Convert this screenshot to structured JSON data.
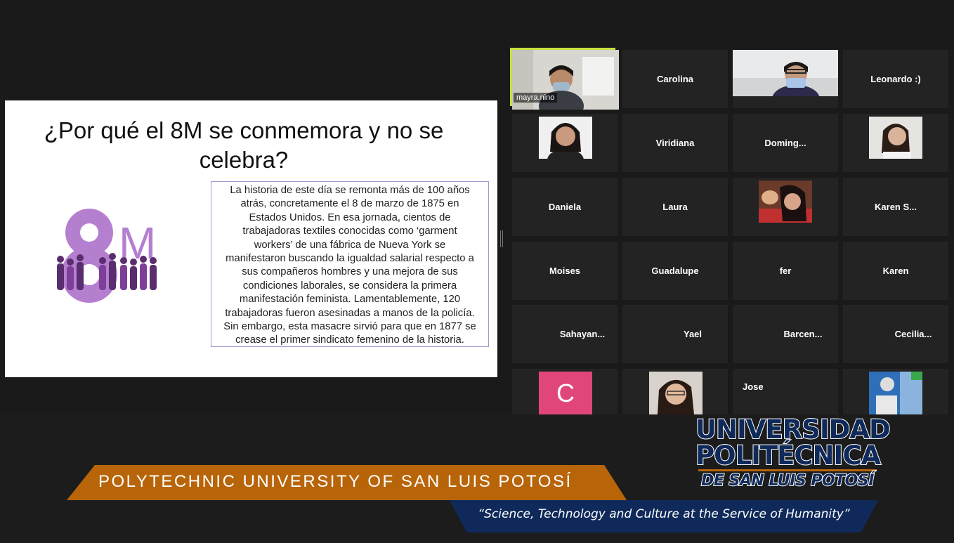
{
  "slide": {
    "title": "¿Por qué el 8M se conmemora y no se celebra?",
    "logo_text": "8M",
    "body": "La historia de este día se remonta más de 100 años\natrás, concretamente el 8 de marzo de 1875 en\nEstados Unidos. En esa jornada, cientos de\ntrabajadoras textiles conocidas como ‘garment\nworkers’ de una fábrica de Nueva York se\nmanifestaron buscando la igualdad salarial respecto a\nsus compañeros hombres y una mejora de sus\ncondiciones laborales, se considera la primera\nmanifestación feminista. Lamentablemente, 120\ntrabajadoras fueron asesinadas a manos de la policía.\nSin embargo, esta masacre sirvió para que en 1877 se\ncrease el primer sindicato femenino de la historia."
  },
  "participants": [
    {
      "name": "mayra.nino",
      "video": true
    },
    {
      "name": "Carolina"
    },
    {
      "name": "",
      "video": true
    },
    {
      "name": "Leonardo :)"
    },
    {
      "name": "",
      "video": true
    },
    {
      "name": "Viridiana"
    },
    {
      "name": "Doming..."
    },
    {
      "name": "",
      "video": true
    },
    {
      "name": "Daniela"
    },
    {
      "name": "Laura"
    },
    {
      "name": "",
      "video": true
    },
    {
      "name": "Karen S..."
    },
    {
      "name": "Moises"
    },
    {
      "name": "Guadalupe"
    },
    {
      "name": "fer"
    },
    {
      "name": "Karen"
    },
    {
      "name": "Sahayan..."
    },
    {
      "name": "Yael"
    },
    {
      "name": "Barcen..."
    },
    {
      "name": "Cecilia..."
    },
    {
      "name": "C",
      "avatar": true
    },
    {
      "name": "",
      "video": true
    },
    {
      "name": "Jose"
    },
    {
      "name": "",
      "video": true
    }
  ],
  "branding": {
    "english_name": "POLYTECHNIC UNIVERSITY OF SAN LUIS POTOSÍ",
    "motto": "“Science, Technology and Culture at the Service of Humanity”",
    "logo_line1": "UNIVERSIDAD",
    "logo_line2": "POLITÉCNICA",
    "logo_line3": "DE SAN LUIS POTOSÍ"
  },
  "colors": {
    "active_speaker": "#c8e03c",
    "purple": "#b57fd0",
    "orange": "#b8650a",
    "navy": "#0f2a5a",
    "avatar_pink": "#e0467a"
  }
}
